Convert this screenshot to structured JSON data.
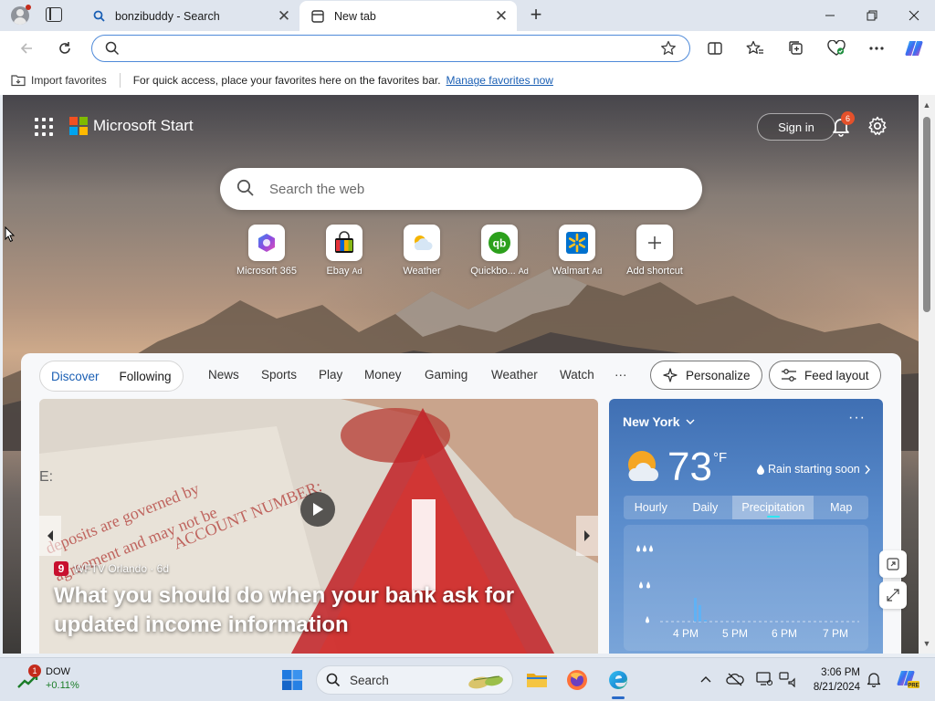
{
  "browser": {
    "tabs": [
      {
        "title": "bonzibuddy - Search",
        "icon": "search-icon"
      },
      {
        "title": "New tab",
        "icon": "newtab-page-icon"
      }
    ],
    "address": {
      "value": "",
      "placeholder": ""
    },
    "favorites_bar": {
      "import_label": "Import favorites",
      "message": "For quick access, place your favorites here on the favorites bar.",
      "link": "Manage favorites now"
    }
  },
  "start": {
    "brand": "Microsoft Start",
    "sign_in": "Sign in",
    "notification_count": "6",
    "search_placeholder": "Search the web",
    "shortcuts": [
      {
        "label": "Microsoft 365",
        "ad": ""
      },
      {
        "label": "Ebay",
        "ad": "Ad"
      },
      {
        "label": "Weather",
        "ad": ""
      },
      {
        "label": "Quickbo...",
        "ad": "Ad"
      },
      {
        "label": "Walmart",
        "ad": "Ad"
      },
      {
        "label": "Add shortcut",
        "ad": ""
      }
    ]
  },
  "feed": {
    "pivots": [
      "Discover",
      "Following"
    ],
    "tabs": [
      "News",
      "Sports",
      "Play",
      "Money",
      "Gaming",
      "Weather",
      "Watch"
    ],
    "more": "···",
    "personalize": "Personalize",
    "feed_layout": "Feed layout",
    "hero": {
      "source": "WFTV Orlando · 6d",
      "source_logo": "9",
      "title": "What you should do when your bank ask for updated income information"
    }
  },
  "weather": {
    "location": "New York",
    "temperature": "73",
    "unit": "°F",
    "summary": "Rain starting soon",
    "tabs": [
      "Hourly",
      "Daily",
      "Precipitation",
      "Map"
    ],
    "active_tab": "Precipitation",
    "chart_times": [
      "4 PM",
      "5 PM",
      "6 PM",
      "7 PM"
    ]
  },
  "taskbar": {
    "stock_name": "DOW",
    "stock_change": "+0.11%",
    "stock_badge": "1",
    "search_label": "Search",
    "time": "3:06 PM",
    "date": "8/21/2024"
  },
  "colors": {
    "accent": "#1a5fb4",
    "address_border": "#4f8ad9",
    "notification_badge": "#e4512b",
    "weather_panel": "#4a7cc0"
  }
}
